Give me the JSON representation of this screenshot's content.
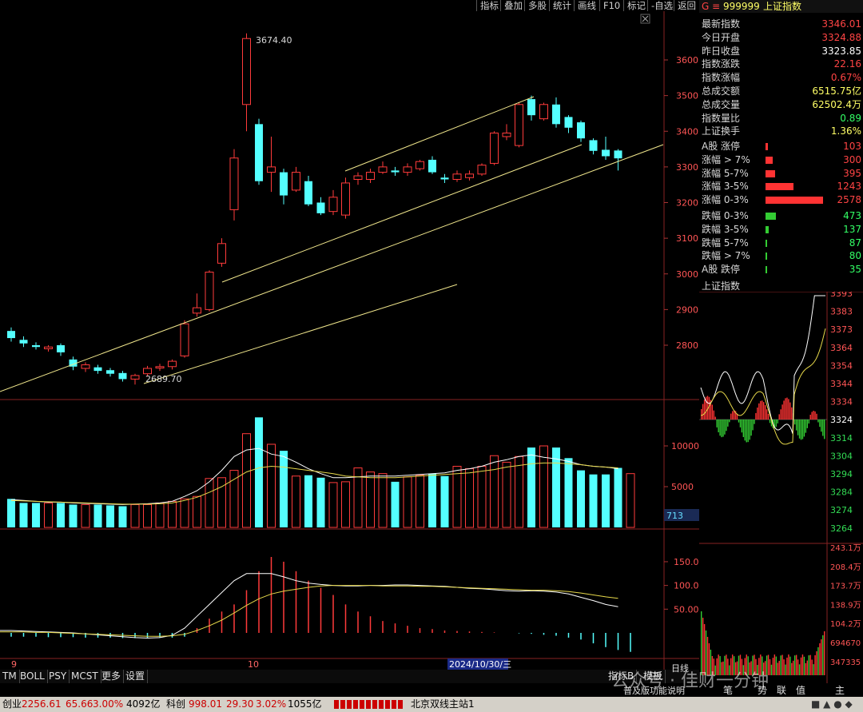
{
  "toolbar": {
    "buttons": [
      "指标",
      "叠加",
      "多股",
      "统计",
      "画线",
      "F10",
      "标记",
      "-自选",
      "返回"
    ]
  },
  "kline": {
    "high_label": "3674.40",
    "low_label": "2689.70",
    "y_ticks": [
      "3600",
      "3500",
      "3400",
      "3300",
      "3200",
      "3100",
      "3000",
      "2900",
      "2800"
    ],
    "candles": [
      {
        "o": 2840,
        "c": 2820,
        "h": 2850,
        "l": 2810,
        "up": false
      },
      {
        "o": 2815,
        "c": 2805,
        "h": 2825,
        "l": 2795,
        "up": false
      },
      {
        "o": 2800,
        "c": 2795,
        "h": 2808,
        "l": 2788,
        "up": false
      },
      {
        "o": 2790,
        "c": 2795,
        "h": 2800,
        "l": 2782,
        "up": true
      },
      {
        "o": 2800,
        "c": 2780,
        "h": 2805,
        "l": 2770,
        "up": false
      },
      {
        "o": 2760,
        "c": 2740,
        "h": 2768,
        "l": 2730,
        "up": false
      },
      {
        "o": 2735,
        "c": 2745,
        "h": 2752,
        "l": 2725,
        "up": true
      },
      {
        "o": 2738,
        "c": 2728,
        "h": 2745,
        "l": 2720,
        "up": false
      },
      {
        "o": 2730,
        "c": 2720,
        "h": 2736,
        "l": 2712,
        "up": false
      },
      {
        "o": 2722,
        "c": 2705,
        "h": 2728,
        "l": 2698,
        "up": false
      },
      {
        "o": 2705,
        "c": 2715,
        "h": 2720,
        "l": 2689.7,
        "up": true
      },
      {
        "o": 2720,
        "c": 2735,
        "h": 2742,
        "l": 2712,
        "up": true
      },
      {
        "o": 2736,
        "c": 2740,
        "h": 2748,
        "l": 2728,
        "up": true
      },
      {
        "o": 2740,
        "c": 2755,
        "h": 2760,
        "l": 2732,
        "up": true
      },
      {
        "o": 2770,
        "c": 2860,
        "h": 2870,
        "l": 2765,
        "up": true
      },
      {
        "o": 2890,
        "c": 2905,
        "h": 2945,
        "l": 2880,
        "up": true
      },
      {
        "o": 2900,
        "c": 3005,
        "h": 3010,
        "l": 2895,
        "up": true
      },
      {
        "o": 3030,
        "c": 3085,
        "h": 3100,
        "l": 3020,
        "up": true
      },
      {
        "o": 3180,
        "c": 3325,
        "h": 3350,
        "l": 3150,
        "up": true
      },
      {
        "o": 3475,
        "c": 3660,
        "h": 3674.4,
        "l": 3400,
        "up": true
      },
      {
        "o": 3420,
        "c": 3260,
        "h": 3435,
        "l": 3250,
        "up": false
      },
      {
        "o": 3300,
        "c": 3285,
        "h": 3385,
        "l": 3230,
        "up": true
      },
      {
        "o": 3285,
        "c": 3220,
        "h": 3295,
        "l": 3195,
        "up": false
      },
      {
        "o": 3235,
        "c": 3285,
        "h": 3300,
        "l": 3230,
        "up": true
      },
      {
        "o": 3260,
        "c": 3195,
        "h": 3275,
        "l": 3190,
        "up": false
      },
      {
        "o": 3200,
        "c": 3170,
        "h": 3215,
        "l": 3165,
        "up": false
      },
      {
        "o": 3175,
        "c": 3215,
        "h": 3235,
        "l": 3165,
        "up": true
      },
      {
        "o": 3165,
        "c": 3255,
        "h": 3270,
        "l": 3155,
        "up": true
      },
      {
        "o": 3265,
        "c": 3275,
        "h": 3285,
        "l": 3250,
        "up": true
      },
      {
        "o": 3265,
        "c": 3285,
        "h": 3295,
        "l": 3255,
        "up": true
      },
      {
        "o": 3285,
        "c": 3300,
        "h": 3315,
        "l": 3280,
        "up": true
      },
      {
        "o": 3290,
        "c": 3285,
        "h": 3300,
        "l": 3275,
        "up": false
      },
      {
        "o": 3285,
        "c": 3300,
        "h": 3310,
        "l": 3275,
        "up": true
      },
      {
        "o": 3295,
        "c": 3315,
        "h": 3320,
        "l": 3290,
        "up": true
      },
      {
        "o": 3320,
        "c": 3285,
        "h": 3330,
        "l": 3280,
        "up": false
      },
      {
        "o": 3270,
        "c": 3265,
        "h": 3280,
        "l": 3255,
        "up": false
      },
      {
        "o": 3265,
        "c": 3280,
        "h": 3290,
        "l": 3258,
        "up": true
      },
      {
        "o": 3270,
        "c": 3280,
        "h": 3290,
        "l": 3262,
        "up": true
      },
      {
        "o": 3280,
        "c": 3305,
        "h": 3310,
        "l": 3275,
        "up": true
      },
      {
        "o": 3310,
        "c": 3395,
        "h": 3400,
        "l": 3305,
        "up": true
      },
      {
        "o": 3385,
        "c": 3395,
        "h": 3420,
        "l": 3375,
        "up": true
      },
      {
        "o": 3360,
        "c": 3475,
        "h": 3480,
        "l": 3355,
        "up": true
      },
      {
        "o": 3490,
        "c": 3445,
        "h": 3500,
        "l": 3430,
        "up": false
      },
      {
        "o": 3435,
        "c": 3475,
        "h": 3480,
        "l": 3430,
        "up": true
      },
      {
        "o": 3475,
        "c": 3420,
        "h": 3495,
        "l": 3410,
        "up": false
      },
      {
        "o": 3440,
        "c": 3410,
        "h": 3445,
        "l": 3395,
        "up": false
      },
      {
        "o": 3425,
        "c": 3380,
        "h": 3430,
        "l": 3370,
        "up": false
      },
      {
        "o": 3375,
        "c": 3345,
        "h": 3380,
        "l": 3335,
        "up": false
      },
      {
        "o": 3348,
        "c": 3330,
        "h": 3385,
        "l": 3320,
        "up": false
      },
      {
        "o": 3346,
        "c": 3324,
        "h": 3350,
        "l": 3290,
        "up": false
      }
    ]
  },
  "volume": {
    "y_ticks": [
      "10000",
      "5000"
    ],
    "current": "713",
    "values": [
      3500,
      3000,
      3000,
      3000,
      3000,
      2800,
      2800,
      2800,
      2700,
      2600,
      2800,
      2800,
      3000,
      3200,
      3500,
      3800,
      6000,
      6100,
      7000,
      11500,
      13500,
      10200,
      9400,
      6300,
      6400,
      6100,
      5500,
      5600,
      7300,
      6800,
      6600,
      5600,
      6200,
      6400,
      6600,
      6300,
      7500,
      7200,
      7500,
      8800,
      8000,
      8700,
      9800,
      10000,
      9800,
      8500,
      7000,
      6500,
      6500,
      7300,
      6600
    ],
    "ma1": [
      3400,
      3300,
      3200,
      3100,
      3100,
      3000,
      2950,
      2900,
      2850,
      2800,
      2850,
      2900,
      3000,
      3200,
      3800,
      4500,
      5600,
      7000,
      8700,
      9500,
      9700,
      9000,
      8700,
      8000,
      7200,
      6600,
      6100,
      6100,
      6200,
      6300,
      6300,
      6300,
      6400,
      6500,
      6600,
      6700,
      7000,
      7200,
      7500,
      8000,
      8300,
      8700,
      8900,
      8600,
      8400,
      8100,
      7700,
      7500,
      7400,
      7200
    ],
    "ma2": [
      3300,
      3250,
      3200,
      3150,
      3100,
      3050,
      3000,
      2950,
      2900,
      2850,
      2850,
      2850,
      2900,
      3000,
      3300,
      3700,
      4300,
      5000,
      5900,
      6800,
      7300,
      7500,
      7400,
      7200,
      7000,
      6800,
      6600,
      6300,
      6200,
      6100,
      6100,
      6100,
      6200,
      6300,
      6400,
      6500,
      6600,
      6700,
      6900,
      7100,
      7400,
      7600,
      7800,
      7900,
      7900,
      7800,
      7700,
      7500,
      7400,
      7300
    ]
  },
  "macd": {
    "y_ticks": [
      "150.0",
      "100.0",
      "50.00"
    ],
    "bars": [
      -8,
      -8,
      -8,
      -9,
      -9,
      -9,
      -10,
      -10,
      -10,
      -11,
      -11,
      -10,
      -10,
      -10,
      -8,
      10,
      30,
      45,
      60,
      90,
      130,
      160,
      150,
      130,
      110,
      95,
      80,
      60,
      45,
      35,
      25,
      20,
      15,
      10,
      8,
      5,
      4,
      3,
      2,
      1,
      0,
      -1,
      -2,
      -4,
      -6,
      -10,
      -14,
      -22,
      -30,
      -36,
      -40
    ],
    "dif": [
      5,
      5,
      4,
      3,
      2,
      1,
      0,
      -2,
      -4,
      -6,
      -8,
      -10,
      -11,
      -10,
      -5,
      10,
      35,
      60,
      85,
      110,
      125,
      125,
      125,
      118,
      110,
      105,
      102,
      100,
      99,
      99,
      100,
      100,
      101,
      101,
      100,
      99,
      98,
      96,
      94,
      93,
      91,
      89,
      88,
      89,
      88,
      86,
      82,
      75,
      68,
      60,
      55
    ],
    "dea": [
      2,
      2,
      2,
      1,
      1,
      0,
      -1,
      -2,
      -3,
      -4,
      -5,
      -6,
      -7,
      -7,
      -6,
      -3,
      5,
      15,
      27,
      42,
      58,
      72,
      82,
      88,
      92,
      96,
      99,
      100,
      100,
      100,
      100,
      99,
      99,
      99,
      98,
      98,
      97,
      96,
      95,
      94,
      93,
      92,
      91,
      90,
      90,
      89,
      87,
      84,
      80,
      76,
      73
    ]
  },
  "x_labels": {
    "sep": "9",
    "oct": "10",
    "cursor_date": "2024/10/30/三"
  },
  "right_panel": {
    "code": "999999",
    "name": "上证指数",
    "prefix": "G",
    "stats": [
      {
        "label": "最新指数",
        "value": "3346.01",
        "color": "#ff4444"
      },
      {
        "label": "今日开盘",
        "value": "3324.88",
        "color": "#ff4444"
      },
      {
        "label": "昨日收盘",
        "value": "3323.85",
        "color": "#ffffff"
      },
      {
        "label": "指数涨跌",
        "value": "22.16",
        "color": "#ff4444"
      },
      {
        "label": "指数涨幅",
        "value": "0.67%",
        "color": "#ff4444"
      },
      {
        "label": "总成交额",
        "value": "6515.75亿",
        "color": "#ffff66"
      },
      {
        "label": "总成交量",
        "value": "62502.4万",
        "color": "#ffff66"
      },
      {
        "label": "指数量比",
        "value": "0.89",
        "color": "#33ff66"
      },
      {
        "label": "上证换手",
        "value": "1.36%",
        "color": "#ffff66"
      }
    ],
    "distribution": [
      {
        "label": "A股 涨停",
        "value": "103",
        "frac": 0.04,
        "color": "#ff3333"
      },
      {
        "label": "涨幅 > 7%",
        "value": "300",
        "frac": 0.12,
        "color": "#ff3333"
      },
      {
        "label": "涨幅 5-7%",
        "value": "395",
        "frac": 0.16,
        "color": "#ff3333"
      },
      {
        "label": "涨幅 3-5%",
        "value": "1243",
        "frac": 0.48,
        "color": "#ff3333"
      },
      {
        "label": "涨幅 0-3%",
        "value": "2578",
        "frac": 1.0,
        "color": "#ff3333"
      },
      {
        "label": "跌幅 0-3%",
        "value": "473",
        "frac": 0.18,
        "color": "#33cc33"
      },
      {
        "label": "跌幅 3-5%",
        "value": "137",
        "frac": 0.06,
        "color": "#33cc33"
      },
      {
        "label": "跌幅 5-7%",
        "value": "87",
        "frac": 0.03,
        "color": "#33cc33"
      },
      {
        "label": "跌幅 > 7%",
        "value": "80",
        "frac": 0.03,
        "color": "#33cc33"
      },
      {
        "label": "A股 跌停",
        "value": "35",
        "frac": 0.015,
        "color": "#33cc33"
      }
    ],
    "mini_title": "上证指数",
    "mini_ticks": [
      "3393",
      "3383",
      "3373",
      "3364",
      "3354",
      "3344",
      "3334",
      "3324",
      "3314",
      "3304",
      "3294",
      "3284",
      "3274",
      "3264"
    ],
    "mini_vol_ticks": [
      "243.1万",
      "208.4万",
      "173.7万",
      "138.9万",
      "104.2万",
      "694670",
      "347335"
    ],
    "mini_tabs": [
      "笔",
      "势",
      "联",
      "值",
      "主"
    ]
  },
  "tabs": [
    "TM",
    "BOLL",
    "PSY",
    "MCST",
    "更多",
    "设置"
  ],
  "tabs_right": [
    "指标B",
    "模板"
  ],
  "tabs_right2": [
    "日线",
    "普及版功能说明"
  ],
  "status": {
    "chuangye_label": "创业",
    "chuangye_val": "2256.61",
    "chuangye_chg": "65.66",
    "chuangye_pct": "3.00%",
    "chuangye_amt": "4092亿",
    "kechuang_label": "科创",
    "kechuang_val": "998.01",
    "kechuang_chg": "29.30",
    "kechuang_pct": "3.02%",
    "kechuang_amt": "1055亿",
    "server": "北京双线主站1"
  },
  "watermark": "公众号 · 佳财一分钟"
}
